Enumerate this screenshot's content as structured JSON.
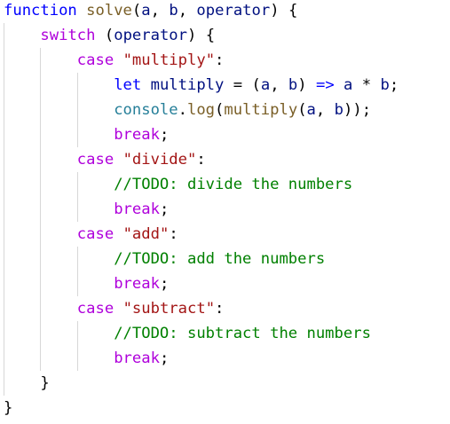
{
  "code_lines": [
    "function solve(a, b, operator) {",
    "    switch (operator) {",
    "        case \"multiply\":",
    "            let multiply = (a, b) => a * b;",
    "            console.log(multiply(a, b));",
    "            break;",
    "        case \"divide\":",
    "            //TODO: divide the numbers",
    "            break;",
    "        case \"add\":",
    "            //TODO: add the numbers",
    "            break;",
    "        case \"subtract\":",
    "            //TODO: subtract the numbers",
    "            break;",
    "    }",
    "}"
  ],
  "colors": {
    "keyword_blue": "#0000ff",
    "keyword_purple": "#af00db",
    "string": "#a31515",
    "comment": "#008000",
    "function": "#795e26",
    "variable": "#001080",
    "type": "#267f99",
    "indent_guide": "#d7d7d7"
  }
}
